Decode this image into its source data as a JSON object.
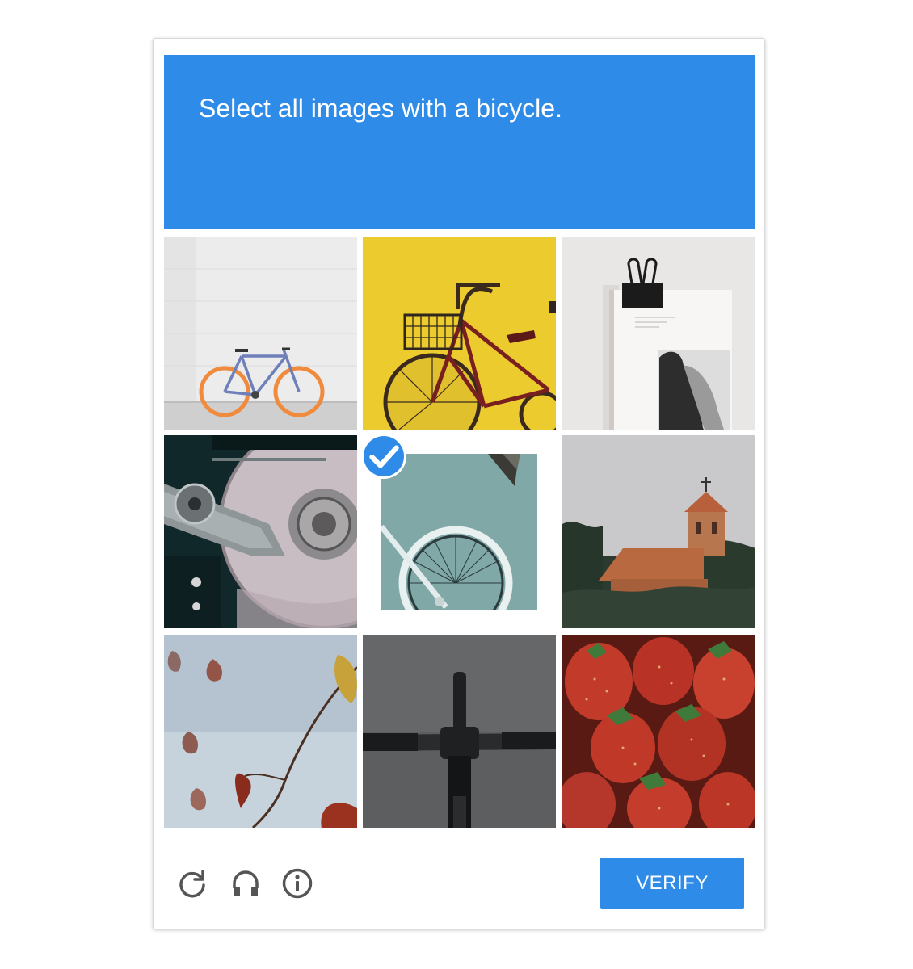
{
  "captcha": {
    "prompt": "Select all images with a bicycle.",
    "verify_label": "VERIFY",
    "accent_color": "#2e8be8",
    "tiles": [
      {
        "subject": "bicycle-against-white-wall",
        "selected": false
      },
      {
        "subject": "bicycle-with-basket-yellow-wall",
        "selected": false
      },
      {
        "subject": "open-book-with-binder-clip",
        "selected": false
      },
      {
        "subject": "hard-drive-platter",
        "selected": false
      },
      {
        "subject": "bicycle-wheel-teal-background",
        "selected": true
      },
      {
        "subject": "church-with-trees",
        "selected": false
      },
      {
        "subject": "autumn-leaves-branch",
        "selected": false
      },
      {
        "subject": "bicycle-handlebars",
        "selected": false
      },
      {
        "subject": "strawberries",
        "selected": false
      }
    ],
    "footer_icons": [
      "reload-icon",
      "headphones-icon",
      "info-icon"
    ]
  }
}
